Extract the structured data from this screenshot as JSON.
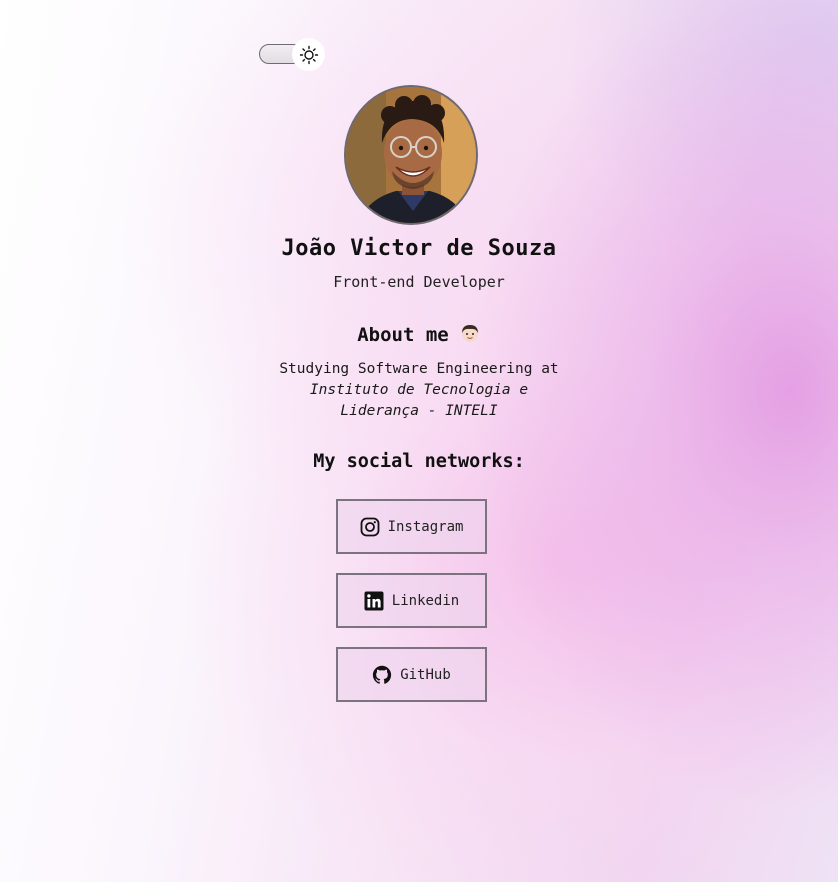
{
  "theme_toggle": {
    "icon": "sun-icon",
    "state": "light"
  },
  "profile": {
    "avatar": "avatar-photo",
    "name": "João Victor de Souza",
    "role": "Front-end Developer"
  },
  "about": {
    "heading": "About me",
    "emoji": "boy-face-emoji",
    "line1": "Studying Software Engineering at",
    "line2": "Instituto de Tecnologia e",
    "line3": "Liderança - INTELI"
  },
  "social": {
    "heading": "My social networks:",
    "links": [
      {
        "label": "Instagram",
        "icon": "instagram-icon"
      },
      {
        "label": "Linkedin",
        "icon": "linkedin-icon"
      },
      {
        "label": "GitHub",
        "icon": "github-icon"
      }
    ]
  },
  "colors": {
    "text": "#111111",
    "button_border": "#7b7380",
    "accent_pink": "#e296e1"
  }
}
